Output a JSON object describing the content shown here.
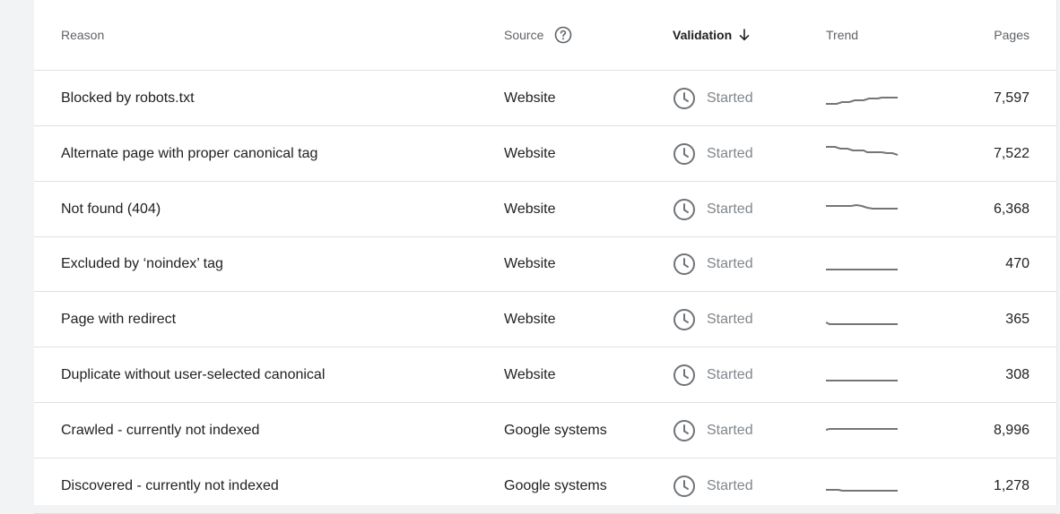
{
  "header": {
    "reason": "Reason",
    "source": "Source",
    "validation": "Validation",
    "trend": "Trend",
    "pages": "Pages"
  },
  "rows": [
    {
      "reason": "Blocked by robots.txt",
      "source": "Website",
      "validation": "Started",
      "pages": "7,597"
    },
    {
      "reason": "Alternate page with proper canonical tag",
      "source": "Website",
      "validation": "Started",
      "pages": "7,522"
    },
    {
      "reason": "Not found (404)",
      "source": "Website",
      "validation": "Started",
      "pages": "6,368"
    },
    {
      "reason": "Excluded by ‘noindex’ tag",
      "source": "Website",
      "validation": "Started",
      "pages": "470"
    },
    {
      "reason": "Page with redirect",
      "source": "Website",
      "validation": "Started",
      "pages": "365"
    },
    {
      "reason": "Duplicate without user-selected canonical",
      "source": "Website",
      "validation": "Started",
      "pages": "308"
    },
    {
      "reason": "Crawled - currently not indexed",
      "source": "Google systems",
      "validation": "Started",
      "pages": "8,996"
    },
    {
      "reason": "Discovered - currently not indexed",
      "source": "Google systems",
      "validation": "Started",
      "pages": "1,278"
    }
  ],
  "icons": {
    "help": "help-circle-icon",
    "sort": "arrow-down-icon",
    "status": "clock-icon"
  },
  "colors": {
    "trend_line": "#757575",
    "status_text": "#80868b",
    "divider": "#e0e0e0"
  }
}
